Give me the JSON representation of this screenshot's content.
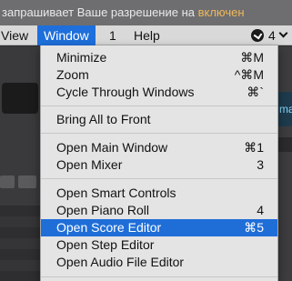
{
  "notification": {
    "text": "запрашивает Ваше разрешение на ",
    "highlight": "включен"
  },
  "menubar": {
    "view": "View",
    "window": "Window",
    "one": "1",
    "help": "Help",
    "status_value": "4"
  },
  "background": {
    "lcd_text": "maj"
  },
  "menu": {
    "items": [
      {
        "label": "Minimize",
        "shortcut": "⌘M"
      },
      {
        "label": "Zoom",
        "shortcut": "^⌘M"
      },
      {
        "label": "Cycle Through Windows",
        "shortcut": "⌘`"
      },
      {
        "label": "Bring All to Front",
        "shortcut": ""
      },
      {
        "label": "Open Main Window",
        "shortcut": "⌘1"
      },
      {
        "label": "Open Mixer",
        "shortcut": "3"
      },
      {
        "label": "Open Smart Controls",
        "shortcut": ""
      },
      {
        "label": "Open Piano Roll",
        "shortcut": "4"
      },
      {
        "label": "Open Score Editor",
        "shortcut": "⌘5"
      },
      {
        "label": "Open Step Editor",
        "shortcut": ""
      },
      {
        "label": "Open Audio File Editor",
        "shortcut": ""
      }
    ]
  }
}
